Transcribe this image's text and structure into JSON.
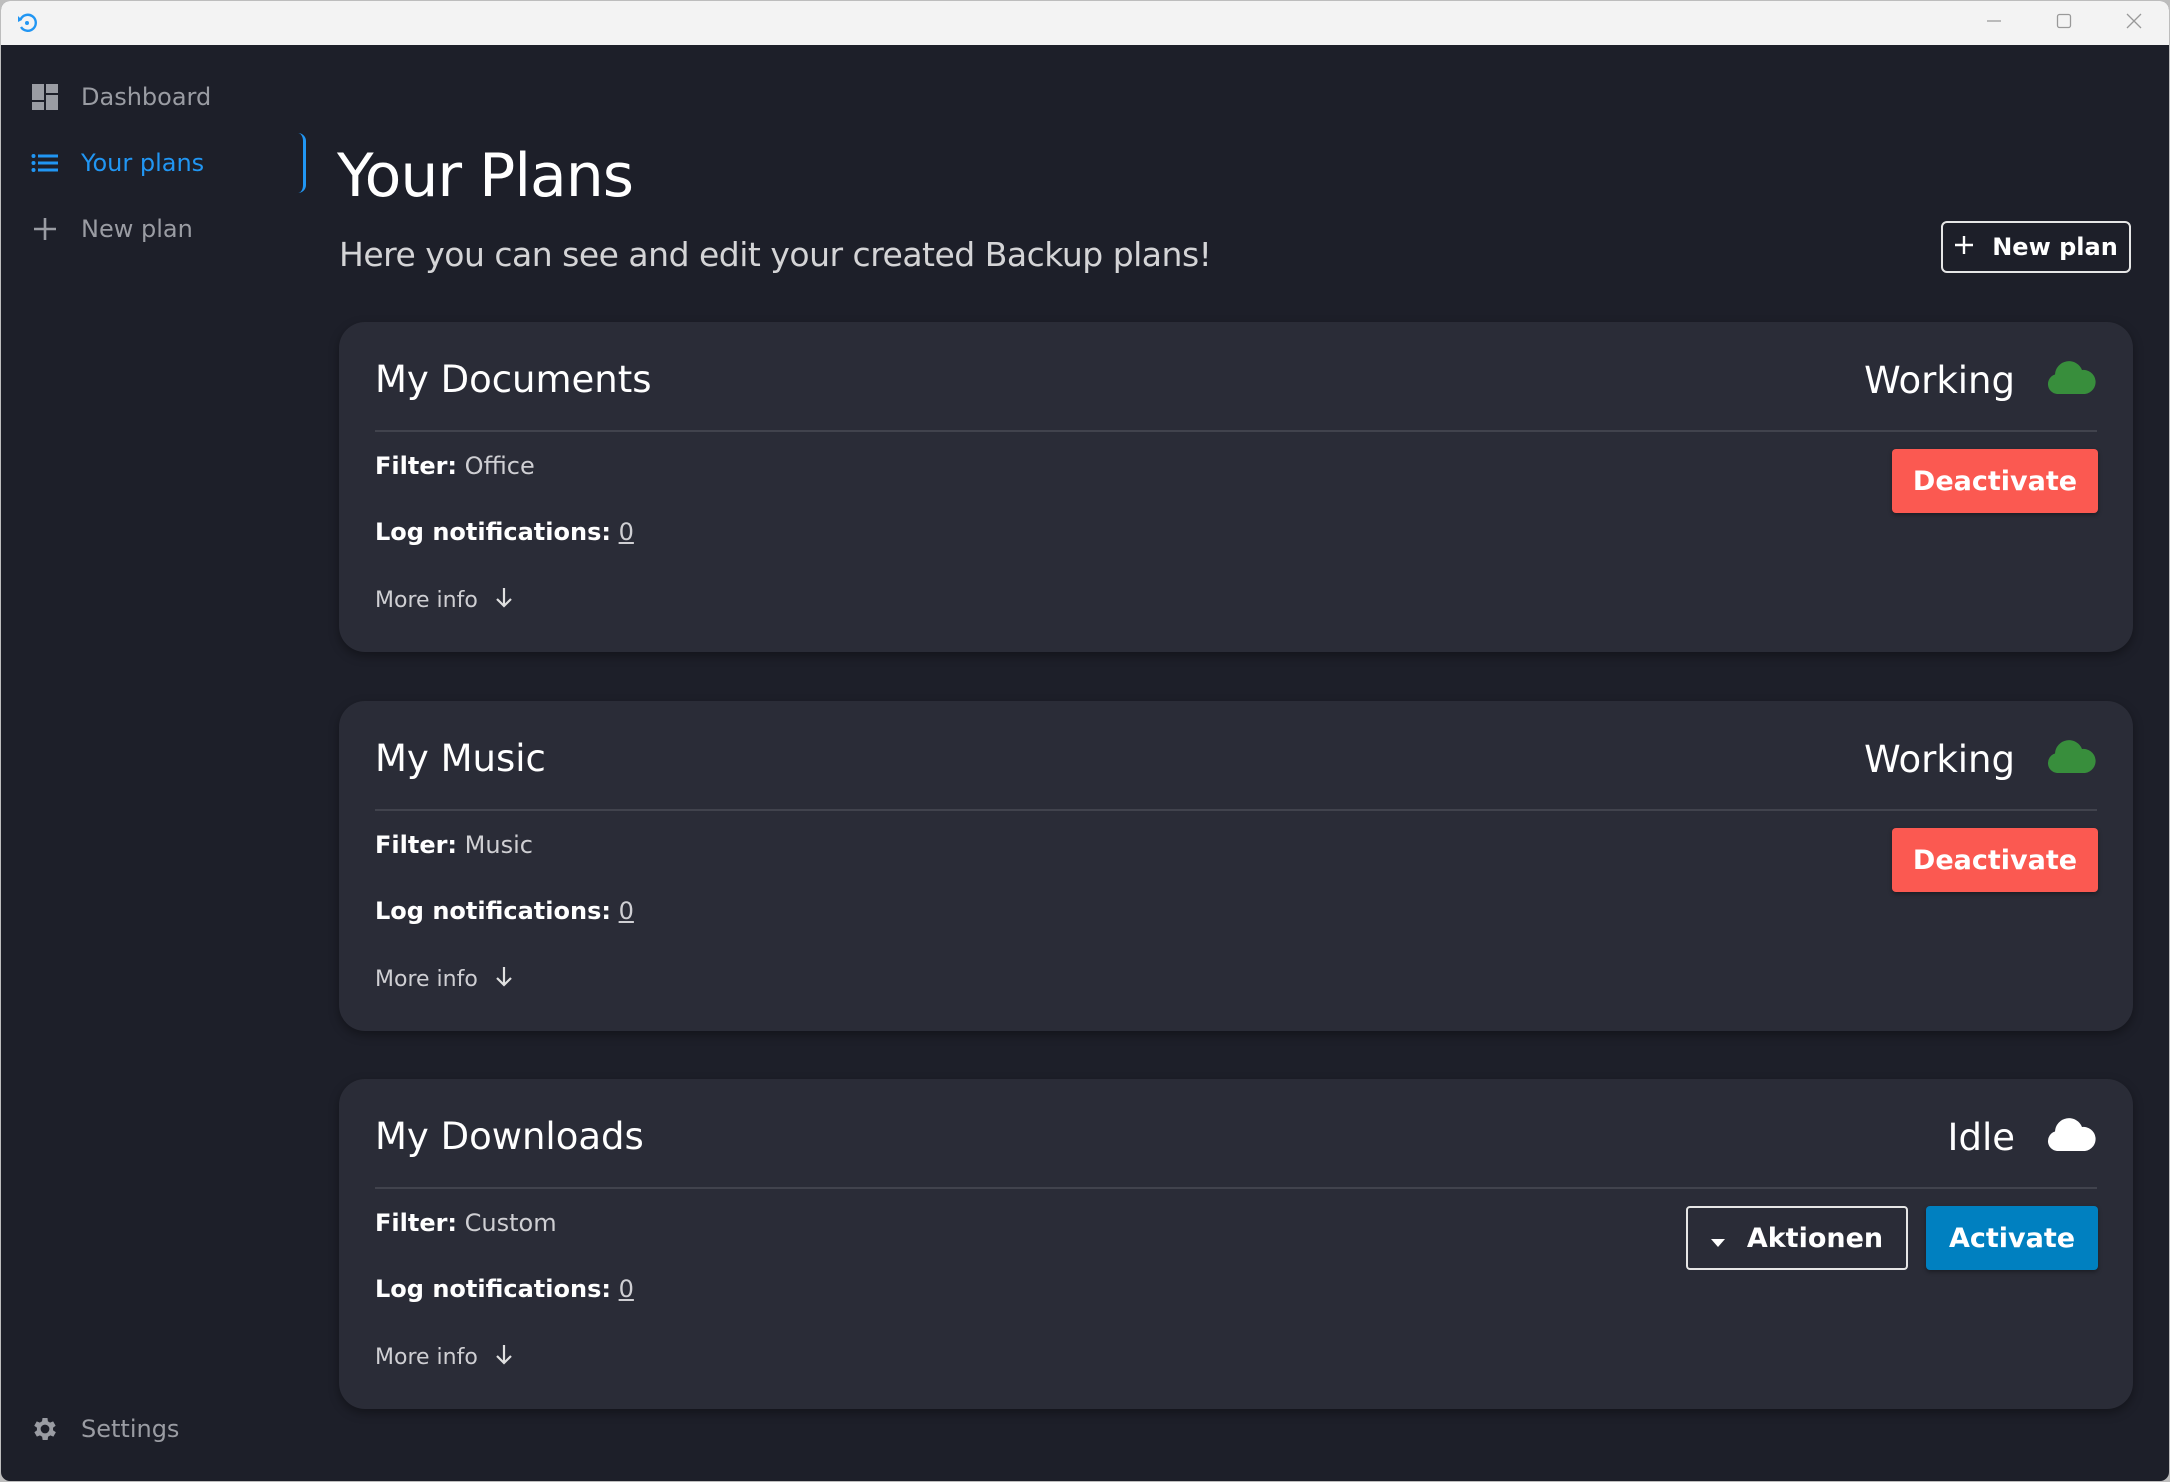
{
  "window": {
    "app_icon": "backup-restore-icon",
    "controls": {
      "minimize": "minimize-icon",
      "maximize": "maximize-icon",
      "close": "close-icon"
    }
  },
  "sidebar": {
    "items": [
      {
        "label": "Dashboard",
        "icon": "dashboard-icon",
        "active": false
      },
      {
        "label": "Your plans",
        "icon": "list-icon",
        "active": true
      },
      {
        "label": "New plan",
        "icon": "plus-icon",
        "active": false
      }
    ],
    "settings": {
      "label": "Settings",
      "icon": "gear-icon"
    }
  },
  "header": {
    "title": "Your Plans",
    "subtitle": "Here you can see and edit your created Backup plans!",
    "new_plan_label": "New plan"
  },
  "colors": {
    "accent": "#2196f3",
    "working": "#388e3c",
    "idle": "#ffffff",
    "deactivate": "#fb5951",
    "activate": "#0080c0"
  },
  "plans": [
    {
      "name": "My Documents",
      "status": "Working",
      "filter_label": "Filter:",
      "filter": "Office",
      "log_label": "Log notifications:",
      "log_count": "0",
      "more_info": "More info",
      "primary_action": "Deactivate"
    },
    {
      "name": "My Music",
      "status": "Working",
      "filter_label": "Filter:",
      "filter": "Music",
      "log_label": "Log notifications:",
      "log_count": "0",
      "more_info": "More info",
      "primary_action": "Deactivate"
    },
    {
      "name": "My Downloads",
      "status": "Idle",
      "filter_label": "Filter:",
      "filter": "Custom",
      "log_label": "Log notifications:",
      "log_count": "0",
      "more_info": "More info",
      "secondary_action": "Aktionen",
      "primary_action": "Activate"
    }
  ]
}
